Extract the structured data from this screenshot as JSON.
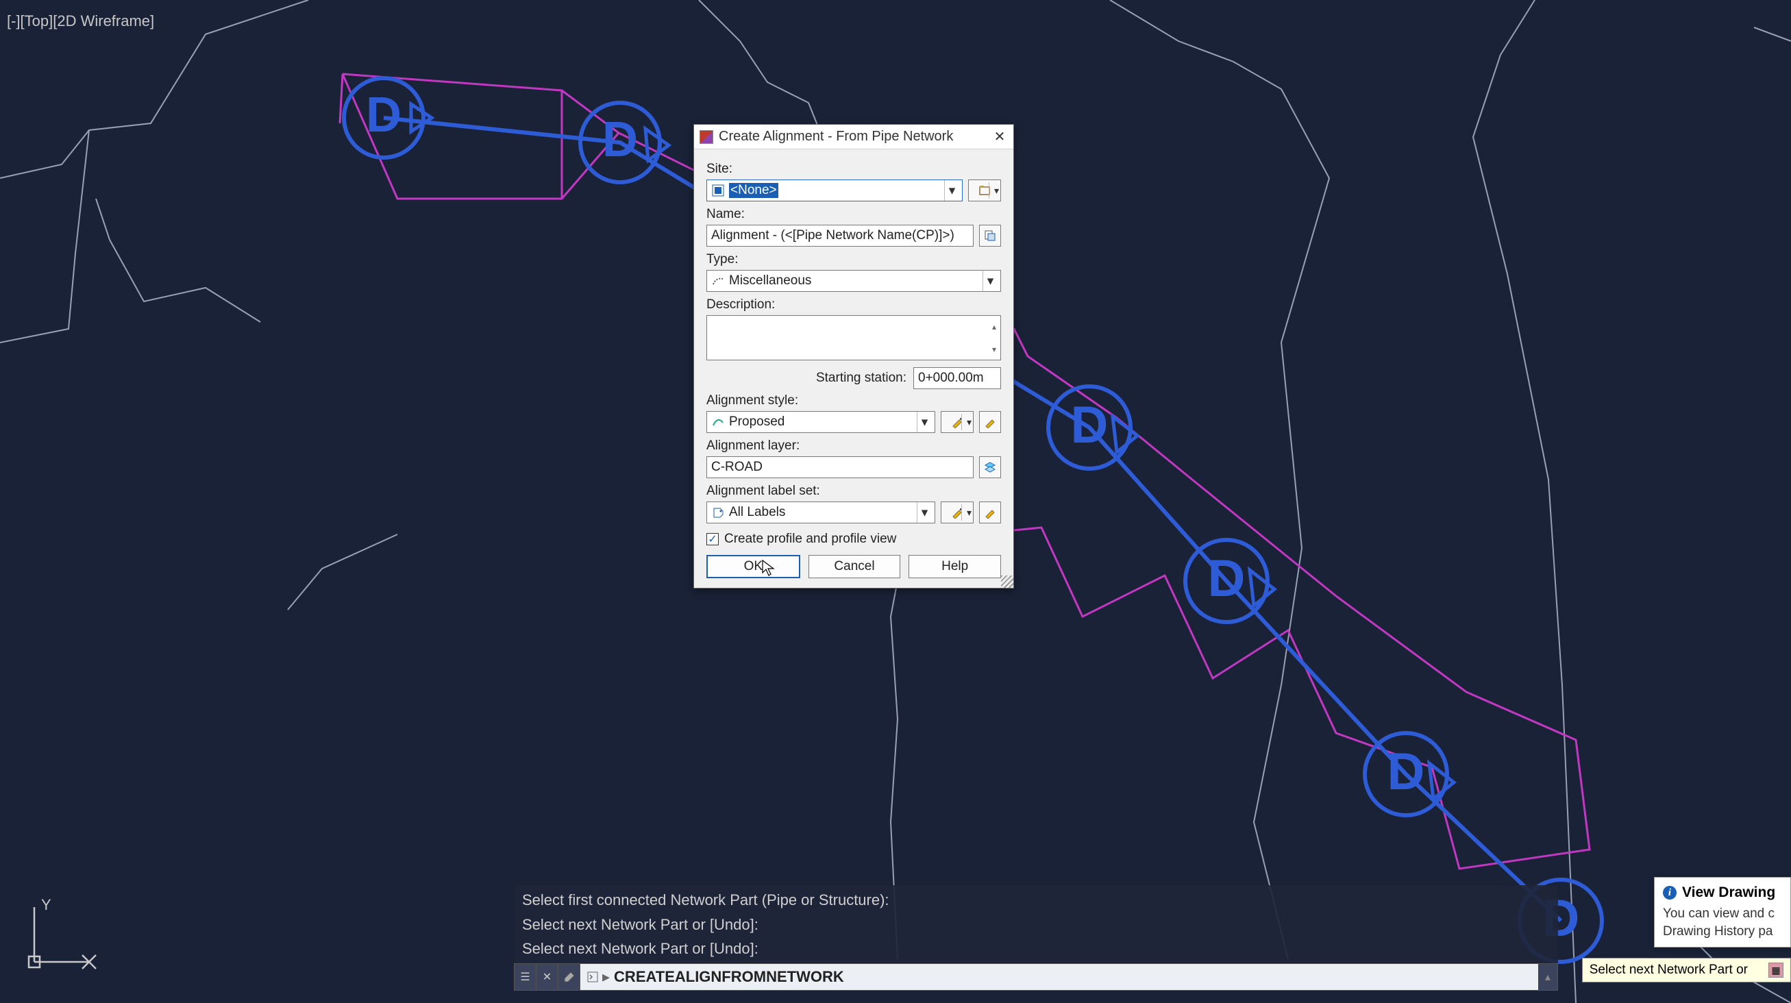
{
  "viewport": {
    "view_label": "[-][Top][2D Wireframe]"
  },
  "dialog": {
    "title": "Create Alignment - From Pipe Network",
    "labels": {
      "site": "Site:",
      "name": "Name:",
      "type": "Type:",
      "description": "Description:",
      "starting_station": "Starting station:",
      "alignment_style": "Alignment style:",
      "alignment_layer": "Alignment layer:",
      "alignment_label_set": "Alignment label set:",
      "create_profile": "Create profile and profile view"
    },
    "values": {
      "site": "<None>",
      "name": "Alignment - (<[Pipe Network Name(CP)]>)",
      "type": "Miscellaneous",
      "description": "",
      "starting_station": "0+000.00m",
      "alignment_style": "Proposed",
      "alignment_layer": "C-ROAD",
      "alignment_label_set": "All Labels",
      "create_profile_checked": true
    },
    "buttons": {
      "ok": "OK",
      "cancel": "Cancel",
      "help": "Help"
    }
  },
  "command": {
    "log": [
      "Select first connected Network Part (Pipe or Structure):",
      "Select next Network Part or [Undo]:",
      "Select next Network Part or [Undo]:"
    ],
    "active": "CREATEALIGNFROMNETWORK"
  },
  "notification": {
    "title": "View Drawing",
    "body": "You can view and c Drawing History pa"
  },
  "tooltip": {
    "text": "Select next Network Part or"
  }
}
